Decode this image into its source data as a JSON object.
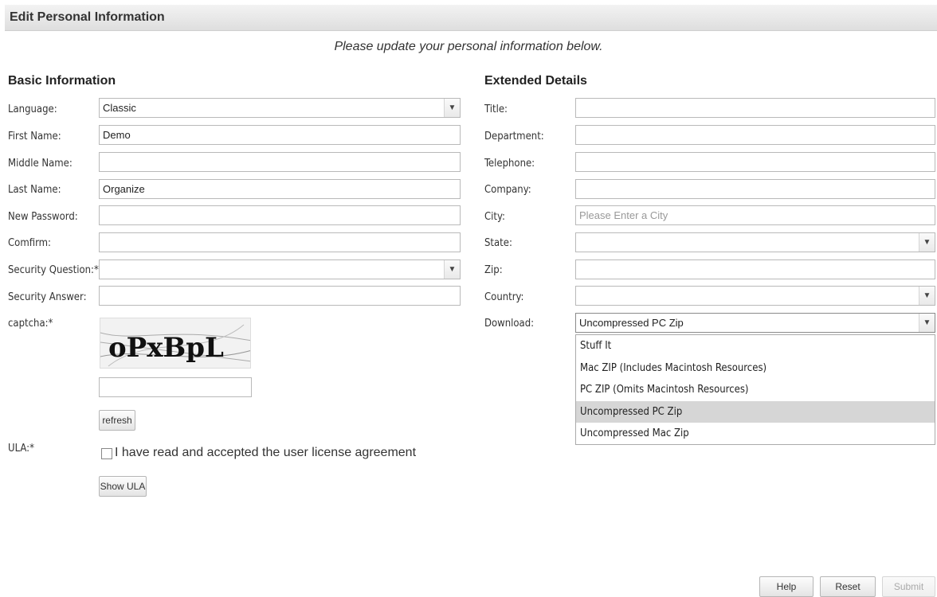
{
  "header": {
    "title": "Edit Personal Information"
  },
  "subtitle": "Please update your personal information below.",
  "basic": {
    "title": "Basic Information",
    "language": {
      "label": "Language:",
      "value": "Classic"
    },
    "first_name": {
      "label": "First Name:",
      "value": "Demo"
    },
    "middle_name": {
      "label": "Middle Name:",
      "value": ""
    },
    "last_name": {
      "label": "Last Name:",
      "value": "Organize"
    },
    "new_password": {
      "label": "New Password:",
      "value": ""
    },
    "confirm": {
      "label": "Comfirm:",
      "value": ""
    },
    "security_question": {
      "label": "Security Question:*",
      "value": ""
    },
    "security_answer": {
      "label": "Security Answer:",
      "value": ""
    },
    "captcha": {
      "label": "captcha:*",
      "image_text": "oPxBpL",
      "value": "",
      "refresh_label": "refresh"
    },
    "ula": {
      "label": "ULA:*",
      "checkbox_text": "I have read and accepted the user license agreement",
      "checked": false,
      "show_label": "Show ULA"
    }
  },
  "extended": {
    "title": "Extended Details",
    "title_field": {
      "label": "Title:",
      "value": ""
    },
    "department": {
      "label": "Department:",
      "value": ""
    },
    "telephone": {
      "label": "Telephone:",
      "value": ""
    },
    "company": {
      "label": "Company:",
      "value": ""
    },
    "city": {
      "label": "City:",
      "placeholder": "Please Enter a City"
    },
    "state": {
      "label": "State:",
      "value": ""
    },
    "zip": {
      "label": "Zip:",
      "value": ""
    },
    "country": {
      "label": "Country:",
      "value": ""
    },
    "download": {
      "label": "Download:",
      "value": "Uncompressed PC Zip",
      "options": [
        "Stuff It",
        "Mac ZIP (Includes Macintosh Resources)",
        "PC ZIP (Omits Macintosh Resources)",
        "Uncompressed PC Zip",
        "Uncompressed Mac Zip"
      ],
      "selected_index": 3
    }
  },
  "buttons": {
    "help": "Help",
    "reset": "Reset",
    "submit": "Submit"
  },
  "icons": {
    "select_arrow": "chevron-down-icon"
  }
}
